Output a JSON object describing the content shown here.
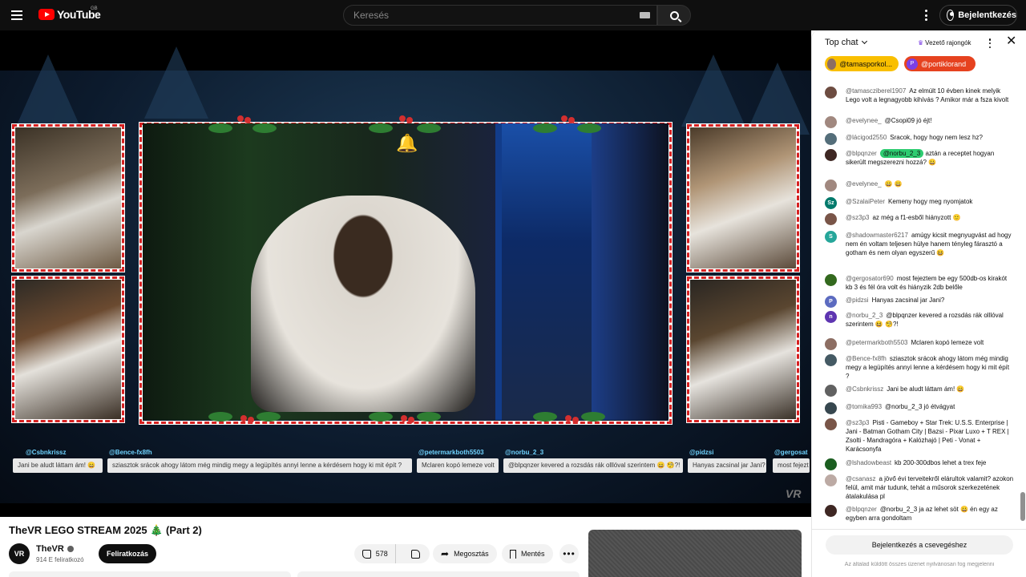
{
  "header": {
    "logo_text": "YouTube",
    "region": "GB",
    "search_placeholder": "Keresés",
    "signin_label": "Bejelentkezés"
  },
  "player": {
    "ticker": [
      {
        "name": "@Csbnkrissz",
        "text": "Jani be aludt láttam ám! 😄"
      },
      {
        "name": "@Bence-fx8fh",
        "text": "sziasztok srácok ahogy látom még mindig megy a legüpítés annyi lenne a kérdésem hogy ki mit épít ?"
      },
      {
        "name": "@petermarkboth5503",
        "text": "Mclaren kopó lemeze volt"
      },
      {
        "name": "@norbu_2_3",
        "text": "@blpqnzer kevered a rozsdás rák olllóval szerintem 😄 🧐?!"
      },
      {
        "name": "@pidzsi",
        "text": "Hanyas zacsinal jar Jani?"
      },
      {
        "name": "@gergosat",
        "text": "most fejezt"
      }
    ],
    "watermark": "VR"
  },
  "video": {
    "title": "TheVR LEGO STREAM 2025 🎄 (Part 2)",
    "channel": "TheVR",
    "channel_avatar": "VR",
    "subscribers": "914 E feliratkozó",
    "subscribe_label": "Feliratkozás",
    "likes": "578",
    "share_label": "Megosztás",
    "save_label": "Mentés"
  },
  "chat": {
    "mode": "Top chat",
    "fans_label": "Vezető rajongók",
    "pinned": [
      {
        "name": "@tamasporkol...",
        "avatar": "",
        "color": "#8d6e63"
      },
      {
        "name": "@portiklorand",
        "avatar": "P",
        "color": "#7b3fe4"
      }
    ],
    "messages": [
      {
        "author": "@tamascziberel1907",
        "text": "Az elmúlt 10 évben kinek melyik Lego volt a legnagyobb kihívás ? Amikor már a fsza kivolt",
        "avatar": "",
        "color": "#6d4c41"
      },
      {
        "author": "@evelynee_",
        "text": "@Csopi09 jó éjt!",
        "avatar": "",
        "color": "#a1887f"
      },
      {
        "author": "@lácigod2550",
        "text": "Sracok, hogy hogy nem lesz hz?",
        "avatar": "",
        "color": "#546e7a"
      },
      {
        "author": "@blpqnzer",
        "mention": "@norbu_2_3",
        "text": "aztán a receptet hogyan sikerült megszerezni hozzá? 😀",
        "avatar": "",
        "color": "#3e2723"
      },
      {
        "author": "@evelynee_",
        "text": "😀 😀",
        "avatar": "",
        "color": "#a1887f"
      },
      {
        "author": "@SzalaiPeter",
        "text": "Kemeny hogy meg nyomjatok",
        "avatar": "Sz",
        "color": "#00796b"
      },
      {
        "author": "@sz3p3",
        "text": "az még a f1-esből hiányzott 🙂",
        "avatar": "",
        "color": "#795548"
      },
      {
        "author": "@shadowmaster6217",
        "text": "amúgy kicsit megnyugvást ad hogy nem én voltam teljesen hülye hanem tényleg fárasztó a gotham és nem olyan egyszerű 😆",
        "avatar": "S",
        "color": "#26a69a"
      },
      {
        "author": "@gergosator690",
        "text": "most fejeztem be egy 500db-os kirakót kb 3 és fél óra volt és hiányzik 2db belőle",
        "avatar": "",
        "color": "#33691e"
      },
      {
        "author": "@pidzsi",
        "text": "Hanyas zacsinal jar Jani?",
        "avatar": "P",
        "color": "#5c6bc0"
      },
      {
        "author": "@norbu_2_3",
        "text": "@blpqnzer kevered a rozsdás rák olllóval szerintem 😆 🧐?!",
        "avatar": "n",
        "color": "#5e35b1"
      },
      {
        "author": "@petermarkboth5503",
        "text": "Mclaren kopó lemeze volt",
        "avatar": "",
        "color": "#8d6e63"
      },
      {
        "author": "@Bence-fx8fh",
        "text": "sziasztok srácok ahogy látom még mindig megy a legüpítés annyi lenne a kérdésem hogy ki mit épít ?",
        "avatar": "",
        "color": "#455a64"
      },
      {
        "author": "@Csbnkrissz",
        "text": "Jani be aludt láttam ám! 😄",
        "avatar": "",
        "color": "#616161"
      },
      {
        "author": "@tomika993",
        "text": "@norbu_2_3 jó étvágyat",
        "avatar": "",
        "color": "#37474f"
      },
      {
        "author": "@sz3p3",
        "text": "Pisti - Gameboy + Star Trek: U.S.S. Enterprise | Jani - Batman Gotham City | Bazsi - Pixar Luxo + T REX | Zsolti - Mandragóra + Kalózhajó | Peti - Vonat + Karácsonyfa",
        "avatar": "",
        "color": "#795548"
      },
      {
        "author": "@lshadowbeast",
        "text": "kb 200-300dbos lehet a trex feje",
        "avatar": "",
        "color": "#1b5e20"
      },
      {
        "author": "@csanasz",
        "text": "a jövő évi terveitekről elárultok valamit? azokon felül, amit már tudunk, tehát a műsorok szerkezetének átalakulása pl",
        "avatar": "",
        "color": "#bcaaa4"
      },
      {
        "author": "@blpqnzer",
        "text": "@norbu_2_3 ja az lehet söt 😀 én egy az egyben arra gondoltam",
        "avatar": "",
        "color": "#3e2723"
      }
    ],
    "signin_label": "Bejelentkezés a csevegéshez",
    "notice": "Az általad küldött összes üzenet nyilvánosan fog megjelenni"
  }
}
